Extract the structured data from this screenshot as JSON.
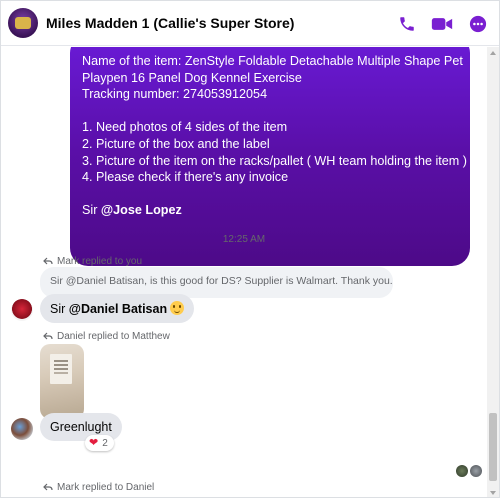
{
  "header": {
    "title": "Miles Madden 1 (Callie's Super Store)",
    "accent_color": "#7a1fd1",
    "icons": [
      "phone-icon",
      "video-camera-icon",
      "more-options-icon"
    ]
  },
  "outgoing_message": {
    "lines": [
      "Name of the item: ZenStyle Foldable Detachable Multiple Shape Pet",
      "Playpen 16 Panel Dog Kennel Exercise",
      "Tracking number: 274053912054",
      "",
      "1. Need photos of 4 sides of the item",
      "2. Picture of the box and the label",
      "3. Picture of the item on the racks/pallet ( WH team holding the item )",
      "4. Please check if there's any invoice",
      ""
    ],
    "closing_prefix": "Sir ",
    "closing_mention": "@Jose Lopez"
  },
  "timestamp": "12:25 AM",
  "thread": {
    "mark_reply": {
      "meta": "Mark replied to you",
      "quoted_text": "Sir @Daniel Batisan, is this good for DS? Supplier is Walmart. Thank you.",
      "reply_prefix": "Sir ",
      "reply_mention": "@Daniel Batisan"
    },
    "daniel_reply": {
      "meta": "Daniel replied to Matthew",
      "message": "Greenlught",
      "reaction_count": "2"
    },
    "last_meta": "Mark replied to Daniel"
  }
}
